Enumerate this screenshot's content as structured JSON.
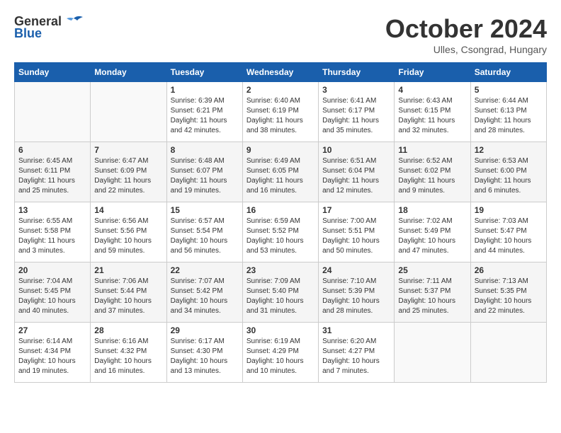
{
  "header": {
    "logo_general": "General",
    "logo_blue": "Blue",
    "month_title": "October 2024",
    "location": "Ulles, Csongrad, Hungary"
  },
  "days_of_week": [
    "Sunday",
    "Monday",
    "Tuesday",
    "Wednesday",
    "Thursday",
    "Friday",
    "Saturday"
  ],
  "weeks": [
    [
      {
        "day": "",
        "info": ""
      },
      {
        "day": "",
        "info": ""
      },
      {
        "day": "1",
        "info": "Sunrise: 6:39 AM\nSunset: 6:21 PM\nDaylight: 11 hours\nand 42 minutes."
      },
      {
        "day": "2",
        "info": "Sunrise: 6:40 AM\nSunset: 6:19 PM\nDaylight: 11 hours\nand 38 minutes."
      },
      {
        "day": "3",
        "info": "Sunrise: 6:41 AM\nSunset: 6:17 PM\nDaylight: 11 hours\nand 35 minutes."
      },
      {
        "day": "4",
        "info": "Sunrise: 6:43 AM\nSunset: 6:15 PM\nDaylight: 11 hours\nand 32 minutes."
      },
      {
        "day": "5",
        "info": "Sunrise: 6:44 AM\nSunset: 6:13 PM\nDaylight: 11 hours\nand 28 minutes."
      }
    ],
    [
      {
        "day": "6",
        "info": "Sunrise: 6:45 AM\nSunset: 6:11 PM\nDaylight: 11 hours\nand 25 minutes."
      },
      {
        "day": "7",
        "info": "Sunrise: 6:47 AM\nSunset: 6:09 PM\nDaylight: 11 hours\nand 22 minutes."
      },
      {
        "day": "8",
        "info": "Sunrise: 6:48 AM\nSunset: 6:07 PM\nDaylight: 11 hours\nand 19 minutes."
      },
      {
        "day": "9",
        "info": "Sunrise: 6:49 AM\nSunset: 6:05 PM\nDaylight: 11 hours\nand 16 minutes."
      },
      {
        "day": "10",
        "info": "Sunrise: 6:51 AM\nSunset: 6:04 PM\nDaylight: 11 hours\nand 12 minutes."
      },
      {
        "day": "11",
        "info": "Sunrise: 6:52 AM\nSunset: 6:02 PM\nDaylight: 11 hours\nand 9 minutes."
      },
      {
        "day": "12",
        "info": "Sunrise: 6:53 AM\nSunset: 6:00 PM\nDaylight: 11 hours\nand 6 minutes."
      }
    ],
    [
      {
        "day": "13",
        "info": "Sunrise: 6:55 AM\nSunset: 5:58 PM\nDaylight: 11 hours\nand 3 minutes."
      },
      {
        "day": "14",
        "info": "Sunrise: 6:56 AM\nSunset: 5:56 PM\nDaylight: 10 hours\nand 59 minutes."
      },
      {
        "day": "15",
        "info": "Sunrise: 6:57 AM\nSunset: 5:54 PM\nDaylight: 10 hours\nand 56 minutes."
      },
      {
        "day": "16",
        "info": "Sunrise: 6:59 AM\nSunset: 5:52 PM\nDaylight: 10 hours\nand 53 minutes."
      },
      {
        "day": "17",
        "info": "Sunrise: 7:00 AM\nSunset: 5:51 PM\nDaylight: 10 hours\nand 50 minutes."
      },
      {
        "day": "18",
        "info": "Sunrise: 7:02 AM\nSunset: 5:49 PM\nDaylight: 10 hours\nand 47 minutes."
      },
      {
        "day": "19",
        "info": "Sunrise: 7:03 AM\nSunset: 5:47 PM\nDaylight: 10 hours\nand 44 minutes."
      }
    ],
    [
      {
        "day": "20",
        "info": "Sunrise: 7:04 AM\nSunset: 5:45 PM\nDaylight: 10 hours\nand 40 minutes."
      },
      {
        "day": "21",
        "info": "Sunrise: 7:06 AM\nSunset: 5:44 PM\nDaylight: 10 hours\nand 37 minutes."
      },
      {
        "day": "22",
        "info": "Sunrise: 7:07 AM\nSunset: 5:42 PM\nDaylight: 10 hours\nand 34 minutes."
      },
      {
        "day": "23",
        "info": "Sunrise: 7:09 AM\nSunset: 5:40 PM\nDaylight: 10 hours\nand 31 minutes."
      },
      {
        "day": "24",
        "info": "Sunrise: 7:10 AM\nSunset: 5:39 PM\nDaylight: 10 hours\nand 28 minutes."
      },
      {
        "day": "25",
        "info": "Sunrise: 7:11 AM\nSunset: 5:37 PM\nDaylight: 10 hours\nand 25 minutes."
      },
      {
        "day": "26",
        "info": "Sunrise: 7:13 AM\nSunset: 5:35 PM\nDaylight: 10 hours\nand 22 minutes."
      }
    ],
    [
      {
        "day": "27",
        "info": "Sunrise: 6:14 AM\nSunset: 4:34 PM\nDaylight: 10 hours\nand 19 minutes."
      },
      {
        "day": "28",
        "info": "Sunrise: 6:16 AM\nSunset: 4:32 PM\nDaylight: 10 hours\nand 16 minutes."
      },
      {
        "day": "29",
        "info": "Sunrise: 6:17 AM\nSunset: 4:30 PM\nDaylight: 10 hours\nand 13 minutes."
      },
      {
        "day": "30",
        "info": "Sunrise: 6:19 AM\nSunset: 4:29 PM\nDaylight: 10 hours\nand 10 minutes."
      },
      {
        "day": "31",
        "info": "Sunrise: 6:20 AM\nSunset: 4:27 PM\nDaylight: 10 hours\nand 7 minutes."
      },
      {
        "day": "",
        "info": ""
      },
      {
        "day": "",
        "info": ""
      }
    ]
  ]
}
